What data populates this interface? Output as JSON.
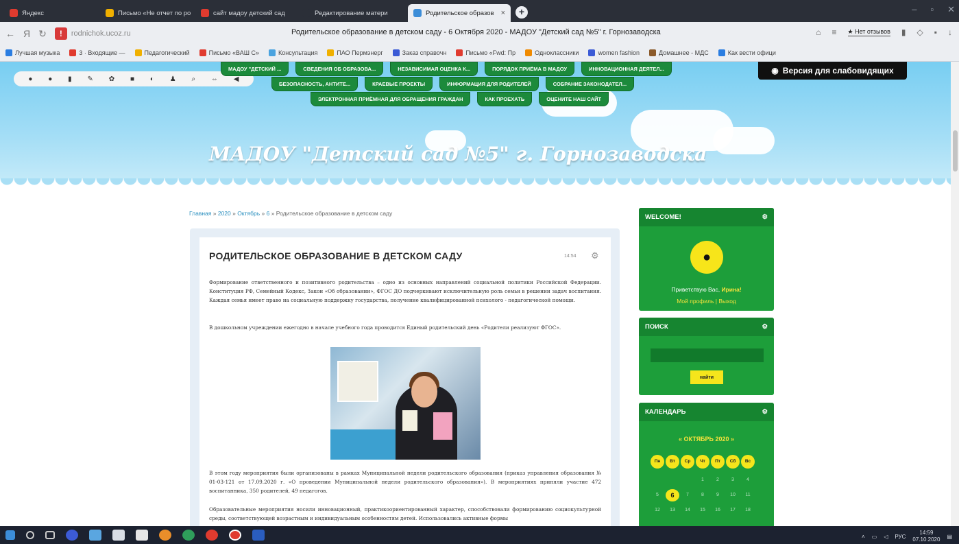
{
  "browser": {
    "tabs": [
      {
        "label": "Яндекс",
        "color": "#e03b2f"
      },
      {
        "label": "Письмо «Не отчет по ро",
        "color": "#f0b000"
      },
      {
        "label": "сайт мадоу детский сад",
        "color": "#e03b2f"
      },
      {
        "label": "Редактирование матери",
        "color": "#2b2f38"
      },
      {
        "label": "Родительское образов",
        "color": "#3c8dd8"
      }
    ],
    "active_tab_index": 4,
    "url": "rodnichok.ucoz.ru",
    "page_title": "Родительское образование в детском саду - 6 Октября 2020 - МАДОУ \"Детский сад №5\" г. Горнозаводска",
    "reviews_label": "★ Нет отзывов",
    "bookmarks": [
      {
        "label": "Лучшая музыка",
        "color": "#2a7de1"
      },
      {
        "label": "3 · Входящие —",
        "color": "#e03b2f"
      },
      {
        "label": "Педагогический",
        "color": "#f0b000"
      },
      {
        "label": "Письмо «ВАШ С»",
        "color": "#e03b2f"
      },
      {
        "label": "Консультация",
        "color": "#4aa3df"
      },
      {
        "label": "ПАО Пермэнерг",
        "color": "#f0b000"
      },
      {
        "label": "Заказ справочн",
        "color": "#3b5bd6"
      },
      {
        "label": "Письмо «Fwd: Пр",
        "color": "#e03b2f"
      },
      {
        "label": "Одноклассники",
        "color": "#f08a00"
      },
      {
        "label": "women fashion",
        "color": "#3b5bd6"
      },
      {
        "label": "Домашнее - МДС",
        "color": "#8b5a2b"
      },
      {
        "label": "Как вести офици",
        "color": "#2a7de1"
      }
    ]
  },
  "site": {
    "title": "МАДОУ \"Детский сад №5\" г. Горнозаводска",
    "low_vision_label": "Версия для слабовидящих",
    "menu": {
      "row1": [
        "МАДОУ \"ДЕТСКИЙ ...",
        "СВЕДЕНИЯ ОБ ОБРАЗОВА...",
        "НЕЗАВИСИМАЯ ОЦЕНКА К...",
        "ПОРЯДОК ПРИЁМА В МАДОУ",
        "ИННОВАЦИОННАЯ ДЕЯТЕЛ..."
      ],
      "row2": [
        "БЕЗОПАСНОСТЬ, АНТИТЕ...",
        "КРАЕВЫЕ ПРОЕКТЫ",
        "ИНФОРМАЦИЯ ДЛЯ РОДИТЕЛЕЙ",
        "СОБРАНИЕ ЗАКОНОДАТЕЛ..."
      ],
      "row3": [
        "ЭЛЕКТРОННАЯ ПРИЁМНАЯ ДЛЯ ОБРАЩЕНИЯ ГРАЖДАН",
        "КАК ПРОЕХАТЬ",
        "ОЦЕНИТЕ НАШ САЙТ"
      ]
    },
    "breadcrumb": [
      "Главная",
      "2020",
      "Октябрь",
      "6",
      "Родительское образование в детском саду"
    ]
  },
  "article": {
    "title": "РОДИТЕЛЬСКОЕ ОБРАЗОВАНИЕ В ДЕТСКОМ САДУ",
    "meta": "14:54",
    "p1": "Формирование ответственного и позитивного родительства – одно из основных направлений социальной политики Российской Федерации. Конституция РФ, Семейный Кодекс, Закон «Об образовании», ФГОС ДО подчеркивают исключительную роль семьи в решении задач воспитания. Каждая семья имеет право на социальную поддержку государства, получение квалифицированной психолого - педагогической помощи.",
    "p2": "В дошкольном учреждении ежегодно в начале учебного года проводится Единый родительский день «Родители реализуют ФГОС».",
    "p3": "В этом году мероприятия были организованы в рамках Муниципальной недели родительского образования (приказ управления образования № 01-03-121 от 17.09.2020 г. «О проведении Муниципальной недели родительского образования»). В мероприятиях приняли участие 472 воспитанника, 350 родителей, 49 педагогов.",
    "p4": "Образовательные мероприятия носили инновационный, практикоориентированный характер, способствовали формированию социокультурной среды, соответствующей возрастным и индивидуальным особенностям детей. Использовались активные формы"
  },
  "widgets": {
    "welcome": {
      "title": "WELCOME!",
      "greeting": "Приветствую Вас,",
      "user": "Ирина!",
      "profile": "Мой профиль",
      "logout": "Выход"
    },
    "search": {
      "title": "ПОИСК",
      "button": "найти"
    },
    "calendar": {
      "title": "КАЛЕНДАРЬ",
      "month": "« ОКТЯБРЬ 2020 »",
      "days_of_week": [
        "Пн",
        "Вт",
        "Ср",
        "Чт",
        "Пт",
        "Сб",
        "Вс"
      ],
      "today": "6",
      "weeks": [
        [
          "",
          "",
          "",
          "1",
          "2",
          "3",
          "4"
        ],
        [
          "5",
          "6",
          "7",
          "8",
          "9",
          "10",
          "11"
        ],
        [
          "12",
          "13",
          "14",
          "15",
          "16",
          "17",
          "18"
        ]
      ]
    }
  },
  "taskbar": {
    "language": "РУС",
    "time": "14:59",
    "date": "07.10.2020"
  }
}
